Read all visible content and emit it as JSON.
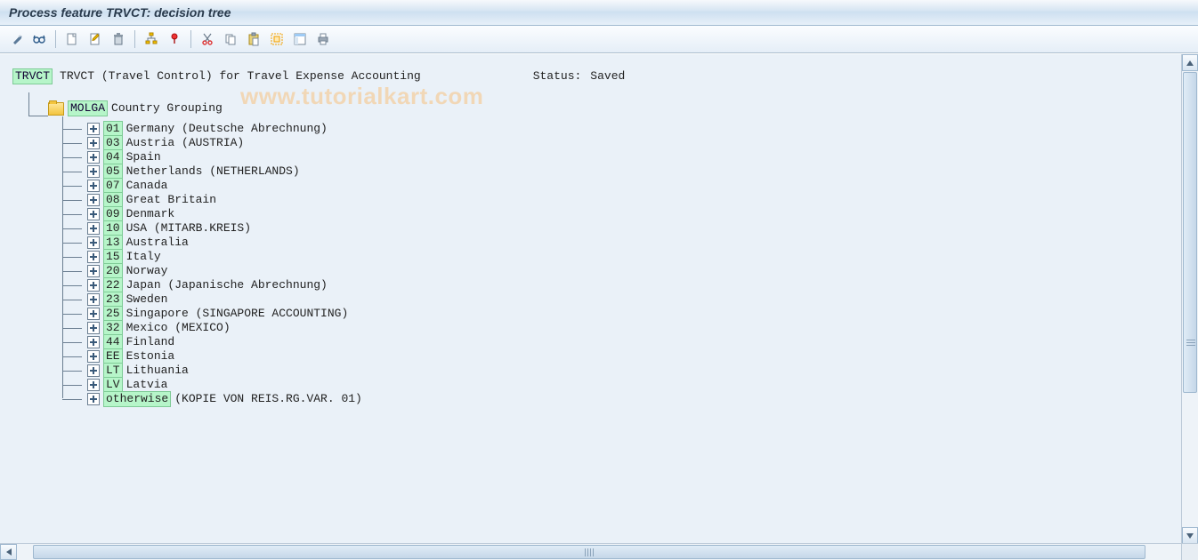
{
  "header": {
    "title": "Process feature TRVCT: decision tree"
  },
  "toolbar": {
    "icons": [
      "wrench-icon",
      "glasses-icon",
      "sep",
      "new-page-icon",
      "edit-page-icon",
      "delete-icon",
      "sep",
      "hierarchy-icon",
      "pin-icon",
      "sep",
      "cut-icon",
      "copy-icon",
      "paste-icon",
      "select-all-icon",
      "layout-icon",
      "print-icon"
    ]
  },
  "root": {
    "code": "TRVCT",
    "desc": "TRVCT (Travel Control) for Travel Expense Accounting",
    "status_label": "Status:",
    "status_value": "Saved"
  },
  "molga": {
    "code": "MOLGA",
    "label": "Country Grouping"
  },
  "items": [
    {
      "code": "01",
      "label": "Germany (Deutsche Abrechnung)"
    },
    {
      "code": "03",
      "label": "Austria (AUSTRIA)"
    },
    {
      "code": "04",
      "label": "Spain"
    },
    {
      "code": "05",
      "label": "Netherlands (NETHERLANDS)"
    },
    {
      "code": "07",
      "label": "Canada"
    },
    {
      "code": "08",
      "label": "Great Britain"
    },
    {
      "code": "09",
      "label": "Denmark"
    },
    {
      "code": "10",
      "label": "USA (MITARB.KREIS)"
    },
    {
      "code": "13",
      "label": "Australia"
    },
    {
      "code": "15",
      "label": "Italy"
    },
    {
      "code": "20",
      "label": "Norway"
    },
    {
      "code": "22",
      "label": "Japan (Japanische Abrechnung)"
    },
    {
      "code": "23",
      "label": "Sweden"
    },
    {
      "code": "25",
      "label": "Singapore (SINGAPORE ACCOUNTING)"
    },
    {
      "code": "32",
      "label": "Mexico (MEXICO)"
    },
    {
      "code": "44",
      "label": "Finland"
    },
    {
      "code": "EE",
      "label": "Estonia"
    },
    {
      "code": "LT",
      "label": "Lithuania"
    },
    {
      "code": "LV",
      "label": "Latvia"
    },
    {
      "code": "otherwise",
      "label": "(KOPIE VON REIS.RG.VAR. 01)"
    }
  ],
  "watermark": "www.tutorialkart.com"
}
